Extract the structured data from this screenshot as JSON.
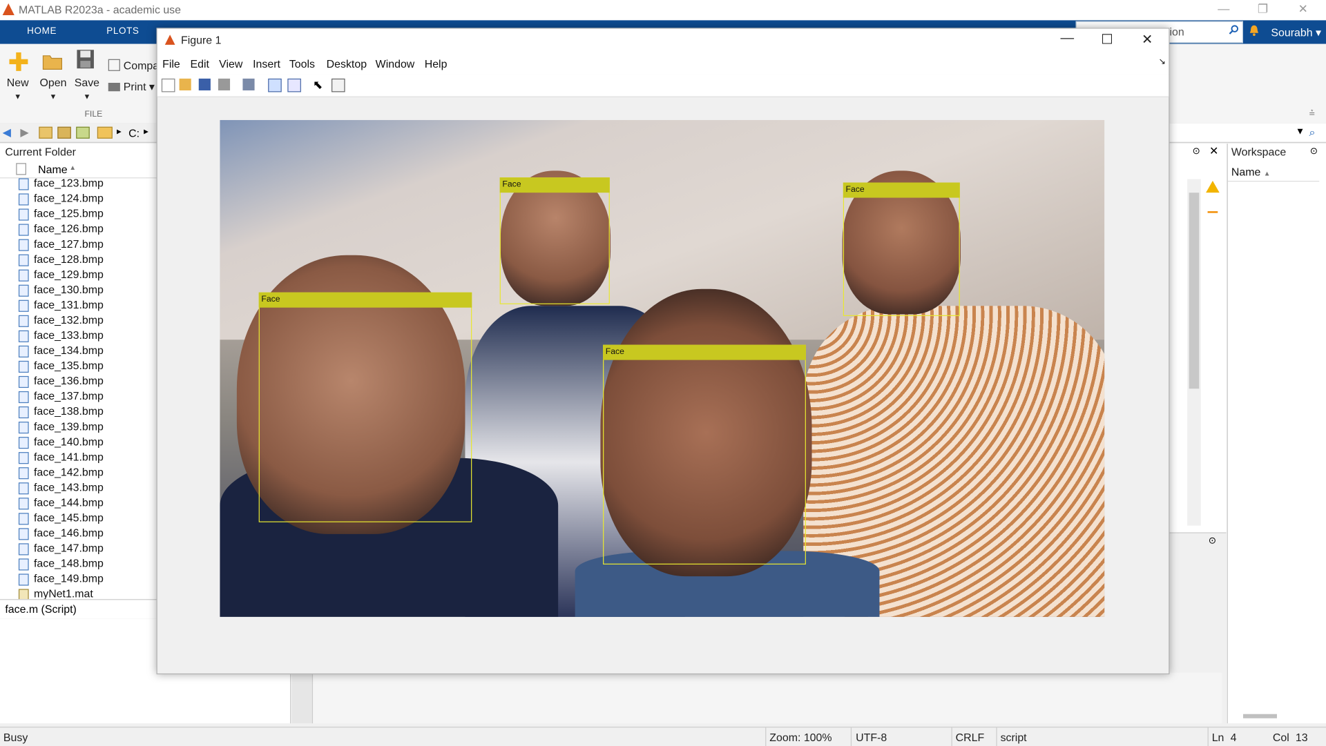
{
  "app": {
    "title": "MATLAB R2023a - academic use"
  },
  "ribbon": {
    "tabs": [
      "HOME",
      "PLOTS"
    ],
    "buttons": {
      "new": "New",
      "open": "Open",
      "save": "Save",
      "compare": "Compa",
      "print": "Print"
    },
    "section": "FILE",
    "search_value": "ion",
    "user": "Sourabh"
  },
  "address": {
    "path": "C:"
  },
  "current_folder": {
    "title": "Current Folder",
    "column": "Name",
    "files": [
      "face_123.bmp",
      "face_124.bmp",
      "face_125.bmp",
      "face_126.bmp",
      "face_127.bmp",
      "face_128.bmp",
      "face_129.bmp",
      "face_130.bmp",
      "face_131.bmp",
      "face_132.bmp",
      "face_133.bmp",
      "face_134.bmp",
      "face_135.bmp",
      "face_136.bmp",
      "face_137.bmp",
      "face_138.bmp",
      "face_139.bmp",
      "face_140.bmp",
      "face_141.bmp",
      "face_142.bmp",
      "face_143.bmp",
      "face_144.bmp",
      "face_145.bmp",
      "face_146.bmp",
      "face_147.bmp",
      "face_148.bmp",
      "face_149.bmp",
      "myNet1.mat"
    ],
    "details": "face.m  (Script)"
  },
  "workspace": {
    "title": "Workspace",
    "column": "Name"
  },
  "figure": {
    "title": "Figure 1",
    "menus": [
      "File",
      "Edit",
      "View",
      "Insert",
      "Tools",
      "Desktop",
      "Window",
      "Help"
    ],
    "detections": [
      {
        "label": "Face"
      },
      {
        "label": "Face"
      },
      {
        "label": "Face"
      },
      {
        "label": "Face"
      }
    ]
  },
  "status": {
    "state": "Busy",
    "zoom": "Zoom: 100%",
    "encoding": "UTF-8",
    "eol": "CRLF",
    "type": "script",
    "ln_label": "Ln",
    "ln": "4",
    "col_label": "Col",
    "col": "13"
  }
}
